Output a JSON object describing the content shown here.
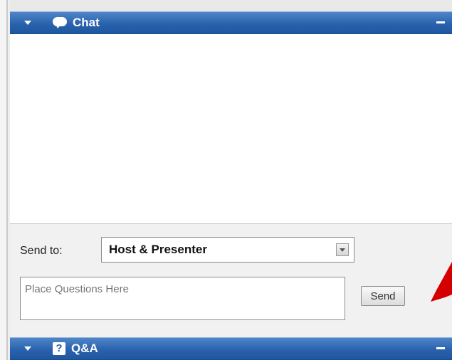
{
  "chat_panel": {
    "title": "Chat",
    "send_to_label": "Send to:",
    "send_to_value": "Host & Presenter",
    "message_placeholder": "Place Questions Here",
    "send_label": "Send"
  },
  "qa_panel": {
    "title": "Q&A",
    "icon_glyph": "?"
  },
  "colors": {
    "titlebar": "#2a62ad",
    "pointer_arrow": "#d40000"
  },
  "icons": [
    "collapse-triangle-icon",
    "chat-bubble-icon",
    "minimize-icon",
    "question-icon",
    "chevron-down-icon",
    "pointer-arrow"
  ]
}
